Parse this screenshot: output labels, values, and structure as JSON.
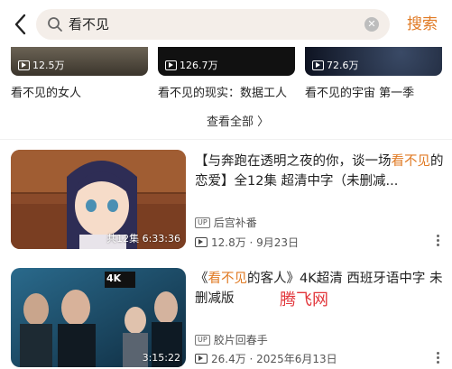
{
  "header": {
    "query": "看不见",
    "search_label": "搜索"
  },
  "top_cards": [
    {
      "count": "12.5万",
      "title": "看不见的女人"
    },
    {
      "count": "126.7万",
      "title": "看不见的现实：数据工人"
    },
    {
      "count": "72.6万",
      "title": "看不见的宇宙 第一季"
    }
  ],
  "see_all": "查看全部 〉",
  "results": [
    {
      "title_pre": "【与奔跑在透明之夜的你，谈一场",
      "title_hl": "看不见",
      "title_post": "的恋爱】全12集 超清中字（未删减...",
      "badge": "共12集 6:33:36",
      "uploader": "后宫补番",
      "stats": "12.8万 · 9月23日"
    },
    {
      "title_pre": "《",
      "title_hl": "看不见",
      "title_post": "的客人》4K超清 西班牙语中字 未删减版",
      "badge": "3:15:22",
      "uploader": "胶片回春手",
      "stats": "26.4万 · 2025年6月13日",
      "thumb_label": "4K"
    }
  ],
  "up_label": "UP",
  "watermark": "腾飞网"
}
